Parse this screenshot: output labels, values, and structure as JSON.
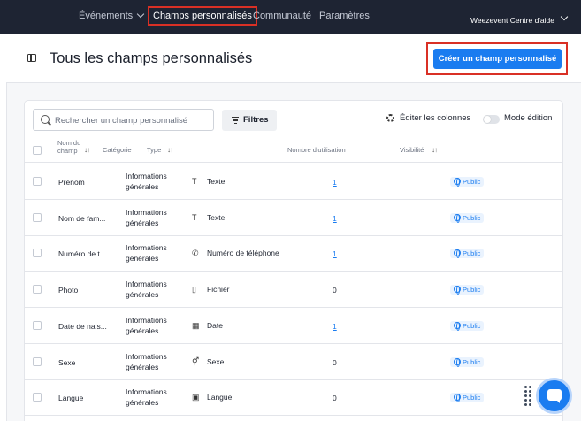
{
  "nav": {
    "events": "Événements",
    "custom_fields": "Champs personnalisés",
    "community": "Communauté",
    "settings": "Paramètres",
    "help": "Weezevent Centre d'aide"
  },
  "header": {
    "title": "Tous les champs personnalisés",
    "create_button": "Créer un champ personnalisé"
  },
  "toolbar": {
    "search_placeholder": "Rechercher un champ personnalisé",
    "filters": "Filtres",
    "edit_columns": "Éditer les colonnes",
    "edit_mode": "Mode édition"
  },
  "table": {
    "columns": {
      "name": "Nom du champ",
      "category": "Catégorie",
      "type": "Type",
      "usage": "Nombre d'utilisation",
      "visibility": "Visibilité"
    },
    "rows": [
      {
        "name": "Prénom",
        "category": "Informations générales",
        "type_icon": "T",
        "type": "Texte",
        "usage": "1",
        "usage_link": true,
        "visibility": "Public"
      },
      {
        "name": "Nom de fam...",
        "category": "Informations générales",
        "type_icon": "T",
        "type": "Texte",
        "usage": "1",
        "usage_link": true,
        "visibility": "Public"
      },
      {
        "name": "Numéro de t...",
        "category": "Informations générales",
        "type_icon": "✆",
        "type": "Numéro de téléphone",
        "usage": "1",
        "usage_link": true,
        "visibility": "Public"
      },
      {
        "name": "Photo",
        "category": "Informations générales",
        "type_icon": "▯",
        "type": "Fichier",
        "usage": "0",
        "usage_link": false,
        "visibility": "Public"
      },
      {
        "name": "Date de nais...",
        "category": "Informations générales",
        "type_icon": "▦",
        "type": "Date",
        "usage": "1",
        "usage_link": true,
        "visibility": "Public"
      },
      {
        "name": "Sexe",
        "category": "Informations générales",
        "type_icon": "⚥",
        "type": "Sexe",
        "usage": "0",
        "usage_link": false,
        "visibility": "Public"
      },
      {
        "name": "Langue",
        "category": "Informations générales",
        "type_icon": "▣",
        "type": "Langue",
        "usage": "0",
        "usage_link": false,
        "visibility": "Public"
      }
    ]
  }
}
